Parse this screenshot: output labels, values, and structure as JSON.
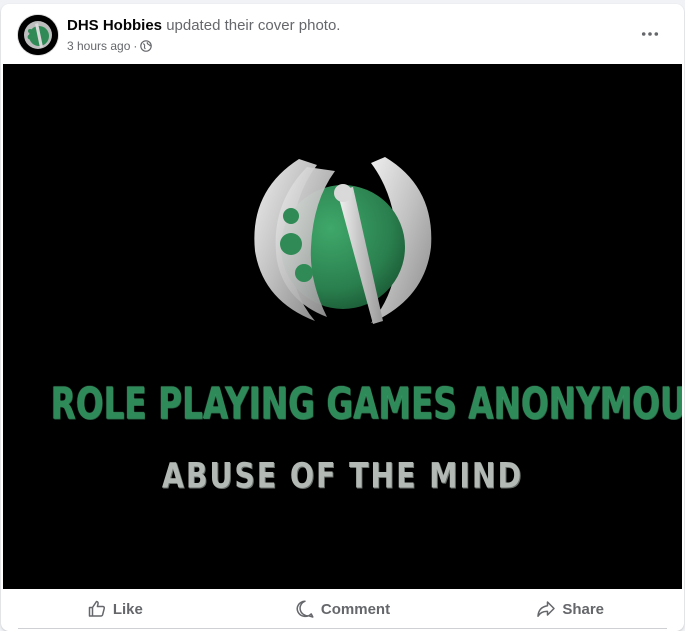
{
  "post": {
    "author": "DHS Hobbies",
    "action_text": "updated their cover photo.",
    "timestamp": "3 hours ago",
    "separator": "·",
    "audience_icon": "globe-icon",
    "more_icon": "more-options-icon"
  },
  "cover": {
    "headline": "ROLE PLAYING GAMES ANONYMOUS",
    "subheadline": "ABUSE OF THE MIND",
    "logo": "battle-axe-logo",
    "colors": {
      "background": "#000000",
      "headline": "#2e8a59",
      "subheadline": "#b3bab5",
      "logo_green": "#2f8a55",
      "logo_silver": "#c8c8c8"
    }
  },
  "actions": {
    "like_label": "Like",
    "comment_label": "Comment",
    "share_label": "Share"
  }
}
